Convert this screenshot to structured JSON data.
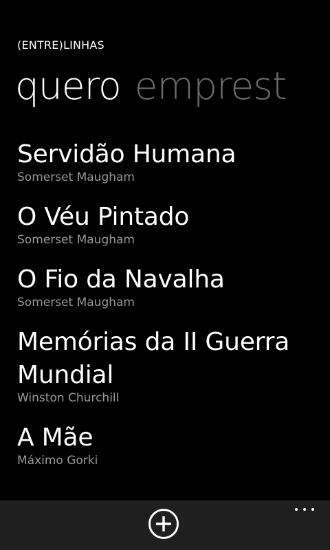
{
  "app": {
    "title": "(ENTRE)LINHAS"
  },
  "pivot": {
    "items": [
      {
        "label": "quero",
        "state": "active"
      },
      {
        "label": "emprest",
        "state": "inactive"
      }
    ]
  },
  "books": [
    {
      "title": "Servidão Humana",
      "author": "Somerset Maugham"
    },
    {
      "title": "O Véu Pintado",
      "author": "Somerset Maugham"
    },
    {
      "title": "O Fio da Navalha",
      "author": "Somerset Maugham"
    },
    {
      "title": "Memórias da II Guerra Mundial",
      "author": "Winston Churchill"
    },
    {
      "title": "A Mãe",
      "author": "Máximo Gorki"
    }
  ],
  "app_bar": {
    "add_icon": "plus-circle-icon",
    "more_icon": "ellipsis-icon"
  },
  "colors": {
    "background": "#000000",
    "app_bar": "#1f1f1f",
    "primary_text": "#ffffff",
    "secondary_text": "#9a9a9a",
    "inactive_pivot": "#6b6b6b"
  }
}
